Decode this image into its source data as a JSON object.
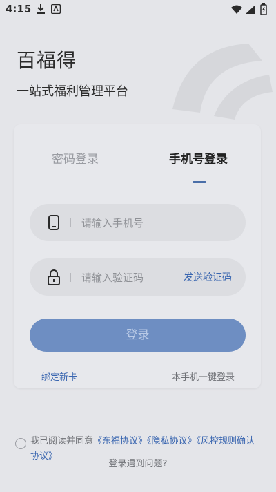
{
  "status": {
    "time": "4:15"
  },
  "brand": {
    "title": "百福得",
    "subtitle": "一站式福利管理平台"
  },
  "tabs": {
    "password": "密码登录",
    "phone": "手机号登录"
  },
  "form": {
    "phone_placeholder": "请输入手机号",
    "code_placeholder": "请输入验证码",
    "send_code": "发送验证码",
    "login": "登录",
    "bind_card": "绑定新卡",
    "onekey_login": "本手机一键登录"
  },
  "agreement": {
    "prefix": "我已阅读并同意",
    "link1": "《东福协议》",
    "link2": "《隐私协议》",
    "link3": "《风控规则确认协议》"
  },
  "help": "登录遇到问题?",
  "colors": {
    "accent": "#3a66b0",
    "button": "#6e8ec2",
    "background": "#e4e5e9"
  }
}
